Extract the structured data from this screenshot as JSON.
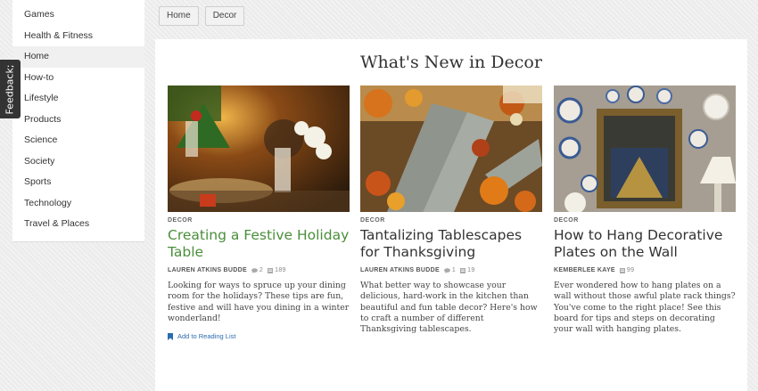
{
  "sidebar": {
    "items": [
      {
        "label": "Games"
      },
      {
        "label": "Health & Fitness"
      },
      {
        "label": "Home"
      },
      {
        "label": "How-to"
      },
      {
        "label": "Lifestyle"
      },
      {
        "label": "Products"
      },
      {
        "label": "Science"
      },
      {
        "label": "Society"
      },
      {
        "label": "Sports"
      },
      {
        "label": "Technology"
      },
      {
        "label": "Travel & Places"
      }
    ],
    "active_label": "Home"
  },
  "feedback": {
    "label": "Feedback;"
  },
  "breadcrumb": {
    "items": [
      {
        "label": "Home"
      },
      {
        "label": "Decor"
      }
    ]
  },
  "main": {
    "heading": "What's New in Decor",
    "cards": [
      {
        "category": "DECOR",
        "title": "Creating a Festive Holiday Table",
        "author": "LAUREN ATKINS BUDDE",
        "comments": "2",
        "views": "189",
        "description": "Looking for ways to spruce up your dining room for the holidays? These tips are fun, festive and will have you dining in a winter wonderland!",
        "reading_list": "Add to Reading List"
      },
      {
        "category": "DECOR",
        "title": "Tantalizing Tablescapes for Thanksgiving",
        "author": "LAUREN ATKINS BUDDE",
        "comments": "1",
        "views": "19",
        "description": "What better way to showcase your delicious, hard-work in the kitchen than beautiful and fun table decor? Here's how to craft a number of different Thanksgiving tablescapes."
      },
      {
        "category": "DECOR",
        "title": "How to Hang Decorative Plates on the Wall",
        "author": "KEMBERLEE KAYE",
        "views": "99",
        "description": "Ever wondered how to hang plates on a wall without those awful plate rack things? You've come to the right place! See this board for tips and steps on decorating your wall with hanging plates."
      }
    ]
  },
  "colors": {
    "title_link": "#4a8e3a",
    "reading_link": "#2a6cb0",
    "feedback_bg": "#333333"
  }
}
